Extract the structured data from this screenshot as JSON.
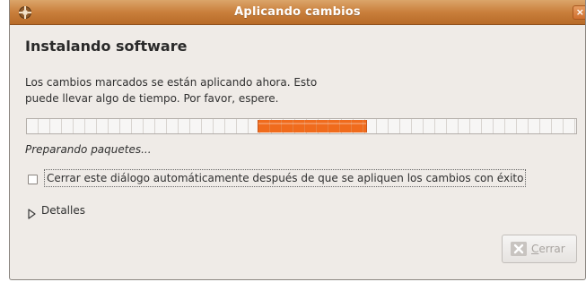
{
  "window": {
    "title": "Aplicando cambios",
    "title_icon": "package-manager-icon",
    "close_glyph": "×"
  },
  "content": {
    "heading": "Instalando software",
    "message_line1": "Los cambios marcados se están aplicando ahora. Esto",
    "message_line2": "puede llevar algo de tiempo. Por favor, espere.",
    "progress": {
      "mode": "indeterminate",
      "pulse_start_fraction": 0.42,
      "pulse_end_fraction": 0.62
    },
    "status": "Preparando paquetes...",
    "auto_close": {
      "label": "Cerrar este diálogo automáticamente después de que se apliquen los cambios con éxito",
      "checked": false
    },
    "details": {
      "label": "Detalles",
      "expanded": false
    }
  },
  "buttons": {
    "close_label": "Cerrar",
    "close_icon": "close-icon",
    "close_enabled": false
  },
  "colors": {
    "titlebar": "#c97f3c",
    "progress_pulse": "#f06b1c",
    "background": "#efebe7"
  }
}
